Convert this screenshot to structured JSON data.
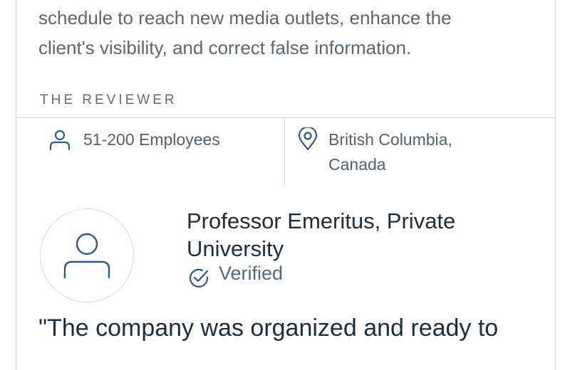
{
  "review": {
    "summary": "schedule to reach new media outlets, enhance the client's visibility, and correct false information.",
    "section_label": "THE REVIEWER",
    "company_size": "51-200 Employees",
    "location": "British Columbia, Canada",
    "reviewer_title": "Professor Emeritus, Private University",
    "verified_label": "Verified",
    "quote_start": "\"The company was organized and ready to"
  },
  "icons": {
    "employees": "person-icon",
    "location": "map-pin-icon",
    "avatar": "user-avatar-icon",
    "verified": "check-circle-icon"
  },
  "colors": {
    "text_primary": "#1e2d3a",
    "text_secondary": "#5a6670",
    "icon_blue": "#2d5a83",
    "border": "#cfdbe1"
  }
}
